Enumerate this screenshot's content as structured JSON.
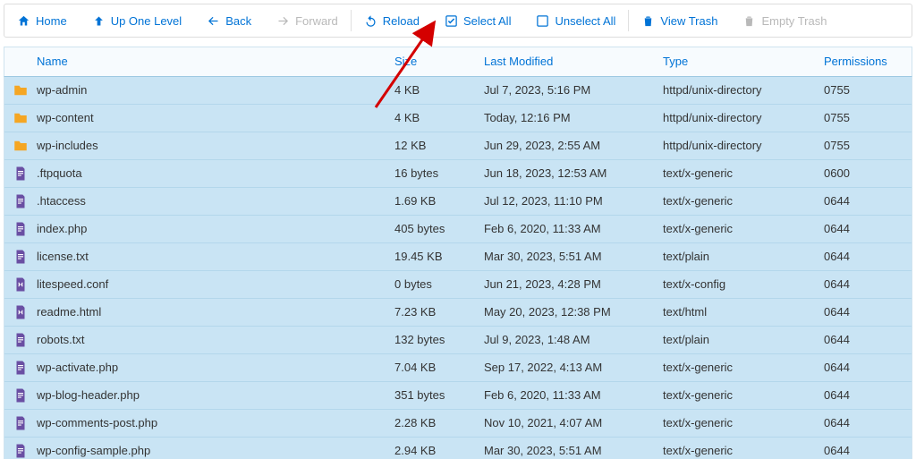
{
  "toolbar": {
    "home": "Home",
    "up": "Up One Level",
    "back": "Back",
    "forward": "Forward",
    "reload": "Reload",
    "select_all": "Select All",
    "unselect_all": "Unselect All",
    "view_trash": "View Trash",
    "empty_trash": "Empty Trash"
  },
  "columns": {
    "name": "Name",
    "size": "Size",
    "last": "Last Modified",
    "type": "Type",
    "perm": "Permissions"
  },
  "rows": [
    {
      "icon": "folder",
      "name": "wp-admin",
      "size": "4 KB",
      "last": "Jul 7, 2023, 5:16 PM",
      "type": "httpd/unix-directory",
      "perm": "0755"
    },
    {
      "icon": "folder",
      "name": "wp-content",
      "size": "4 KB",
      "last": "Today, 12:16 PM",
      "type": "httpd/unix-directory",
      "perm": "0755"
    },
    {
      "icon": "folder",
      "name": "wp-includes",
      "size": "12 KB",
      "last": "Jun 29, 2023, 2:55 AM",
      "type": "httpd/unix-directory",
      "perm": "0755"
    },
    {
      "icon": "file",
      "name": ".ftpquota",
      "size": "16 bytes",
      "last": "Jun 18, 2023, 12:53 AM",
      "type": "text/x-generic",
      "perm": "0600"
    },
    {
      "icon": "file",
      "name": ".htaccess",
      "size": "1.69 KB",
      "last": "Jul 12, 2023, 11:10 PM",
      "type": "text/x-generic",
      "perm": "0644"
    },
    {
      "icon": "file",
      "name": "index.php",
      "size": "405 bytes",
      "last": "Feb 6, 2020, 11:33 AM",
      "type": "text/x-generic",
      "perm": "0644"
    },
    {
      "icon": "file",
      "name": "license.txt",
      "size": "19.45 KB",
      "last": "Mar 30, 2023, 5:51 AM",
      "type": "text/plain",
      "perm": "0644"
    },
    {
      "icon": "config",
      "name": "litespeed.conf",
      "size": "0 bytes",
      "last": "Jun 21, 2023, 4:28 PM",
      "type": "text/x-config",
      "perm": "0644"
    },
    {
      "icon": "config",
      "name": "readme.html",
      "size": "7.23 KB",
      "last": "May 20, 2023, 12:38 PM",
      "type": "text/html",
      "perm": "0644"
    },
    {
      "icon": "file",
      "name": "robots.txt",
      "size": "132 bytes",
      "last": "Jul 9, 2023, 1:48 AM",
      "type": "text/plain",
      "perm": "0644"
    },
    {
      "icon": "file",
      "name": "wp-activate.php",
      "size": "7.04 KB",
      "last": "Sep 17, 2022, 4:13 AM",
      "type": "text/x-generic",
      "perm": "0644"
    },
    {
      "icon": "file",
      "name": "wp-blog-header.php",
      "size": "351 bytes",
      "last": "Feb 6, 2020, 11:33 AM",
      "type": "text/x-generic",
      "perm": "0644"
    },
    {
      "icon": "file",
      "name": "wp-comments-post.php",
      "size": "2.28 KB",
      "last": "Nov 10, 2021, 4:07 AM",
      "type": "text/x-generic",
      "perm": "0644"
    },
    {
      "icon": "file",
      "name": "wp-config-sample.php",
      "size": "2.94 KB",
      "last": "Mar 30, 2023, 5:51 AM",
      "type": "text/x-generic",
      "perm": "0644"
    }
  ]
}
